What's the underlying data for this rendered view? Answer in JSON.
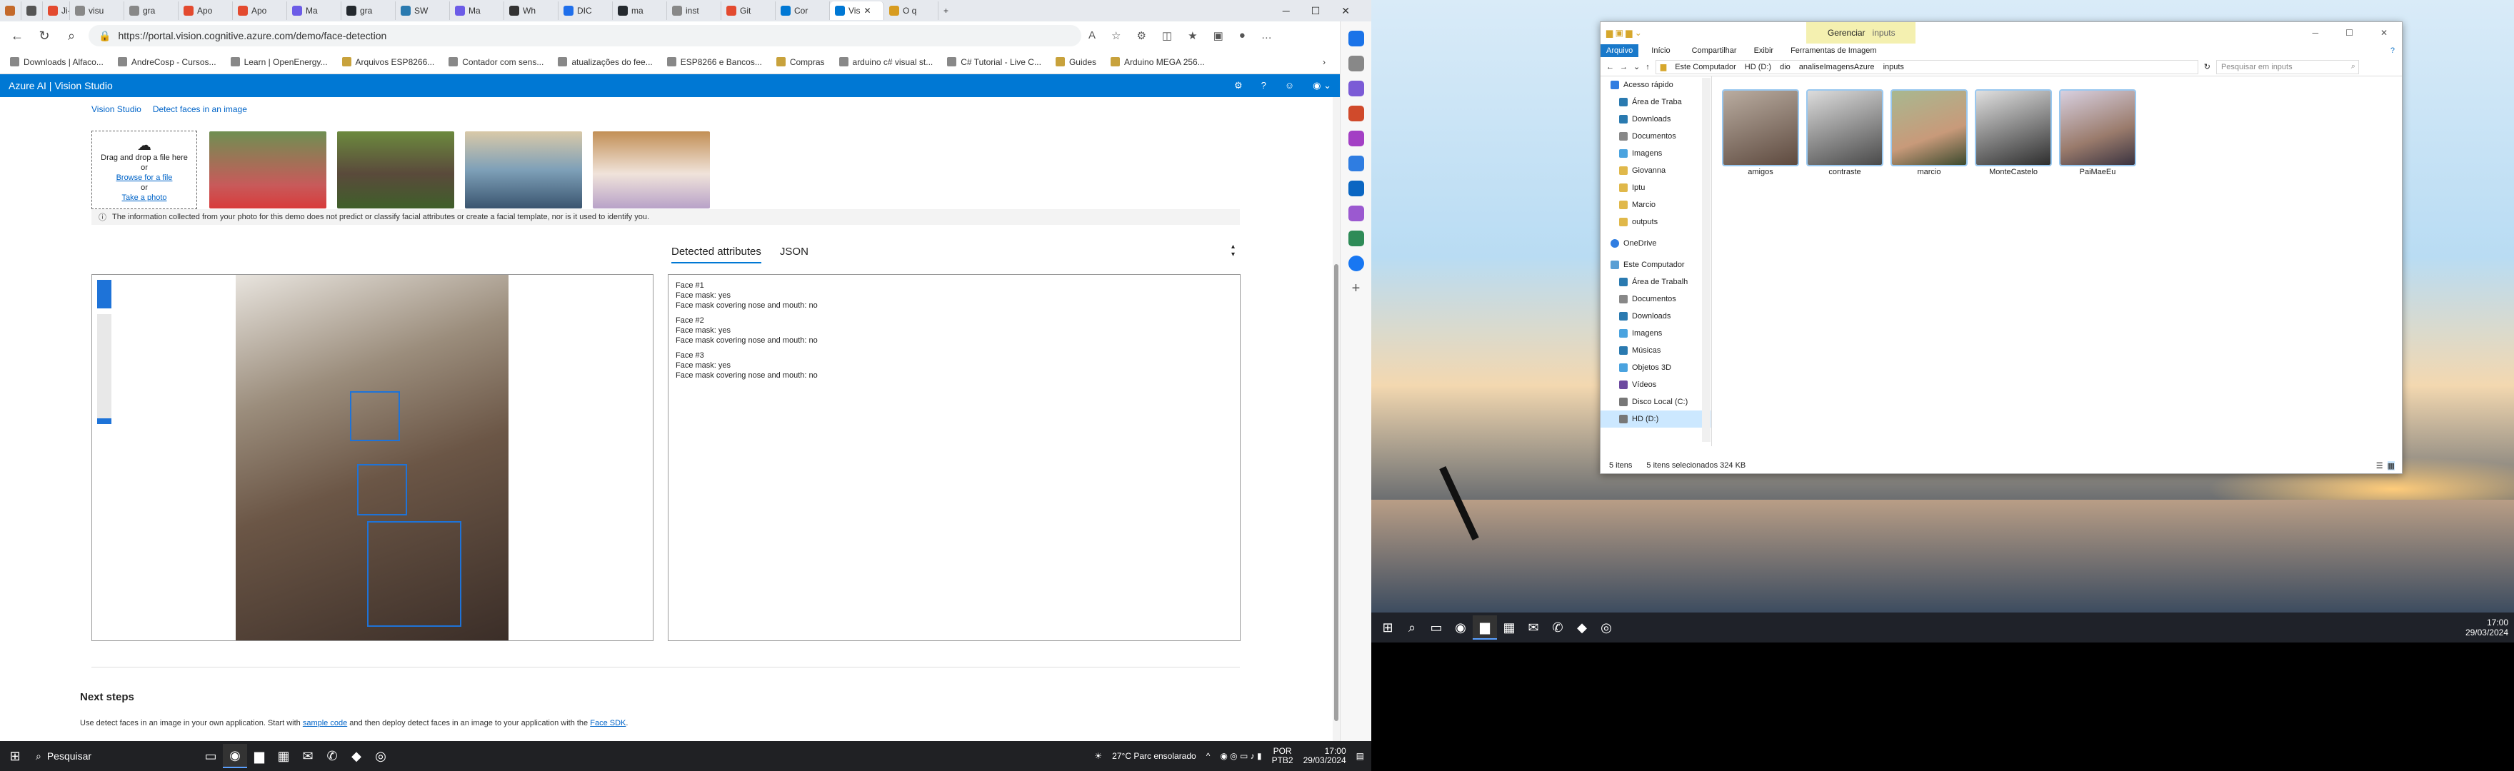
{
  "browser": {
    "tabs": [
      "Ji-Pr",
      "visu",
      "gra",
      "Apo",
      "Apo",
      "Ma",
      "gra",
      "SW",
      "Ma",
      "Wh",
      "DIC",
      "ma",
      "inst",
      "Git",
      "Cor",
      "Vis",
      "O q"
    ],
    "active_tab": 15,
    "url": "https://portal.vision.cognitive.azure.com/demo/face-detection",
    "bookmarks": [
      "Downloads | Alfaco...",
      "AndreCosp - Cursos...",
      "Learn | OpenEnergy...",
      "Arquivos ESP8266...",
      "Contador com sens...",
      "atualizações do fee...",
      "ESP8266 e Bancos...",
      "Compras",
      "arduino c# visual st...",
      "C# Tutorial - Live C...",
      "Guides",
      "Arduino MEGA 256..."
    ]
  },
  "azure": {
    "title": "Azure AI  |  Vision Studio"
  },
  "page": {
    "breadcrumb": [
      "Vision Studio",
      "Detect faces in an image"
    ],
    "drop": {
      "line1": "Drag and drop a file here",
      "line2": "or",
      "browse": "Browse for a file",
      "line3": "or",
      "take": "Take a photo"
    },
    "info": "The information collected from your photo for this demo does not predict or classify facial attributes or create a facial template, nor is it used to identify you.",
    "tabs": {
      "attributes": "Detected attributes",
      "json": "JSON"
    },
    "results": [
      "Face #1",
      "Face mask: yes",
      "Face mask covering nose and mouth: no",
      "Face #2",
      "Face mask: yes",
      "Face mask covering nose and mouth: no",
      "Face #3",
      "Face mask: yes",
      "Face mask covering nose and mouth: no"
    ],
    "next_title": "Next steps",
    "next_text": "Use detect faces in an image in your own application. Start with",
    "next_link1": "sample code",
    "next_mid": "and then deploy detect faces in an image to your application with the",
    "next_link2": "Face SDK",
    "next_end": "."
  },
  "taskbar1": {
    "search": "Pesquisar",
    "weather": "27°C  Parc ensolarado",
    "lang1": "POR",
    "lang2": "PTB2",
    "time": "17:00",
    "date": "29/03/2024"
  },
  "explorer": {
    "ribbon_tabs": [
      "Arquivo",
      "Início",
      "Compartilhar",
      "Exibir",
      "Ferramentas de Imagem"
    ],
    "manage": "Gerenciar",
    "title": "inputs",
    "path": [
      "Este Computador",
      "HD (D:)",
      "dio",
      "analiseImagensAzure",
      "inputs"
    ],
    "search": "Pesquisar em inputs",
    "nav": [
      "Acesso rápido",
      "Área de Traba",
      "Downloads",
      "Documentos",
      "Imagens",
      "Giovanna",
      "Iptu",
      "Marcio",
      "outputs",
      "OneDrive",
      "Este Computador",
      "Área de Trabalh",
      "Documentos",
      "Downloads",
      "Imagens",
      "Músicas",
      "Objetos 3D",
      "Vídeos",
      "Disco Local (C:)",
      "HD (D:)"
    ],
    "files": [
      "amigos",
      "contraste",
      "marcio",
      "MonteCastelo",
      "PaiMaeEu"
    ],
    "status1": "5 itens",
    "status2": "5 itens selecionados  324 KB"
  },
  "taskbar2": {
    "time": "17:00",
    "date": "29/03/2024"
  }
}
